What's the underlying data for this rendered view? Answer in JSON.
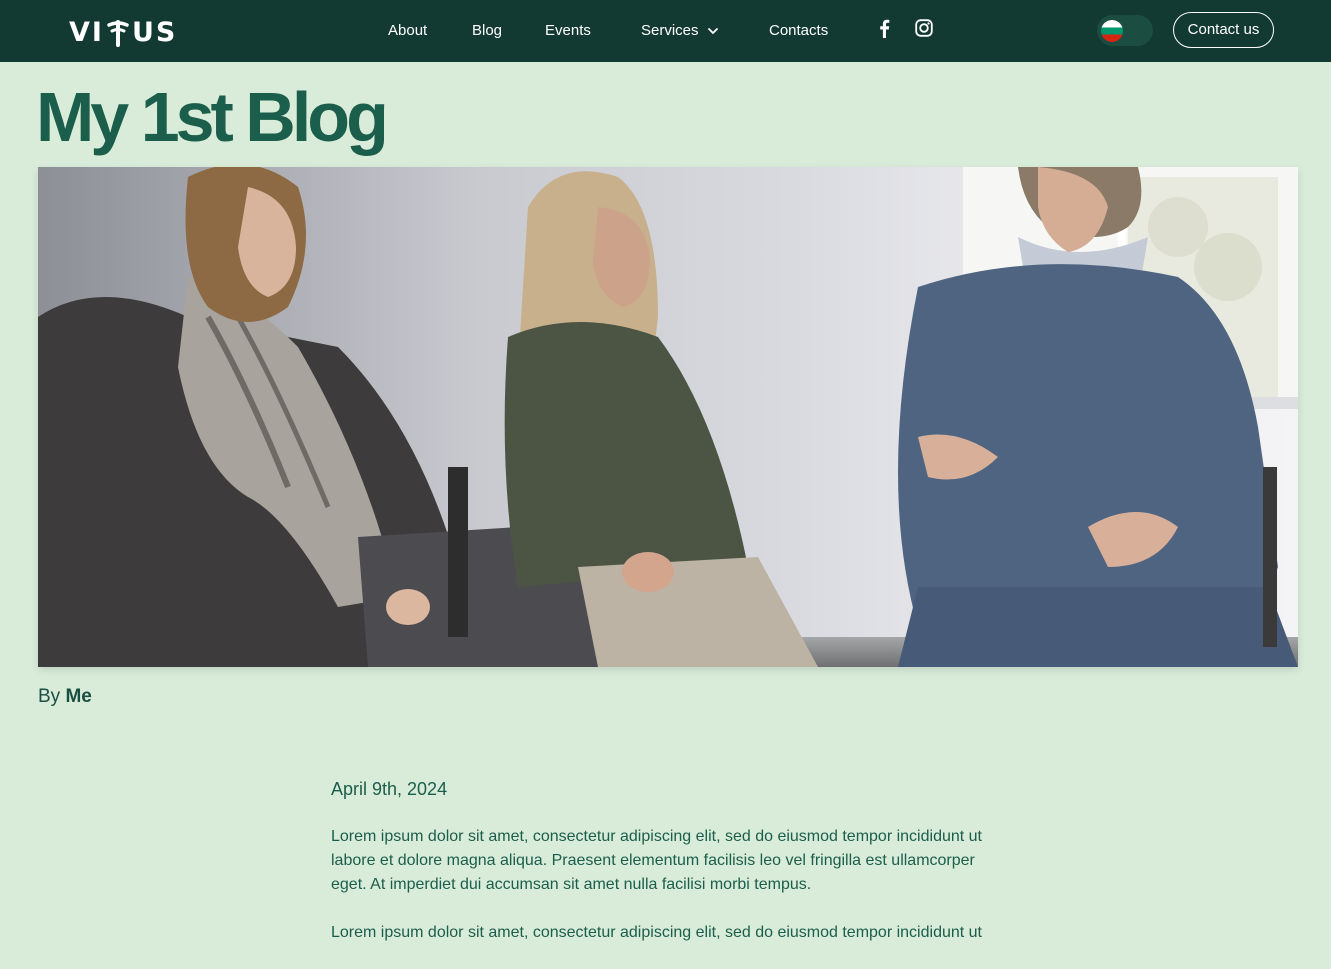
{
  "brand": {
    "logo_prefix": "VI",
    "logo_suffix": "US",
    "logo_full": "VITUS"
  },
  "nav": {
    "about": "About",
    "blog": "Blog",
    "events": "Events",
    "services": "Services",
    "contacts": "Contacts"
  },
  "social": {
    "facebook_icon": "facebook-icon",
    "instagram_icon": "instagram-icon"
  },
  "language": {
    "flag_icon": "bulgarian-flag-icon"
  },
  "header": {
    "contact_label": "Contact us"
  },
  "post": {
    "title": "My 1st Blog",
    "by_label": "By",
    "author": "Me",
    "date": "April 9th, 2024",
    "paragraphs": [
      "Lorem ipsum dolor sit amet, consectetur adipiscing elit, sed do eiusmod tempor incididunt ut labore et dolore magna aliqua. Praesent elementum facilisis leo vel fringilla est ullamcorper eget. At imperdiet dui accumsan sit amet nulla facilisi morbi tempus.",
      "Lorem ipsum dolor sit amet, consectetur adipiscing elit, sed do eiusmod tempor incididunt ut"
    ]
  },
  "colors": {
    "navbar_bg": "#133a32",
    "page_bg": "#d9ecda",
    "title_green": "#1b5e4b",
    "text_green": "#1b5e4b"
  }
}
